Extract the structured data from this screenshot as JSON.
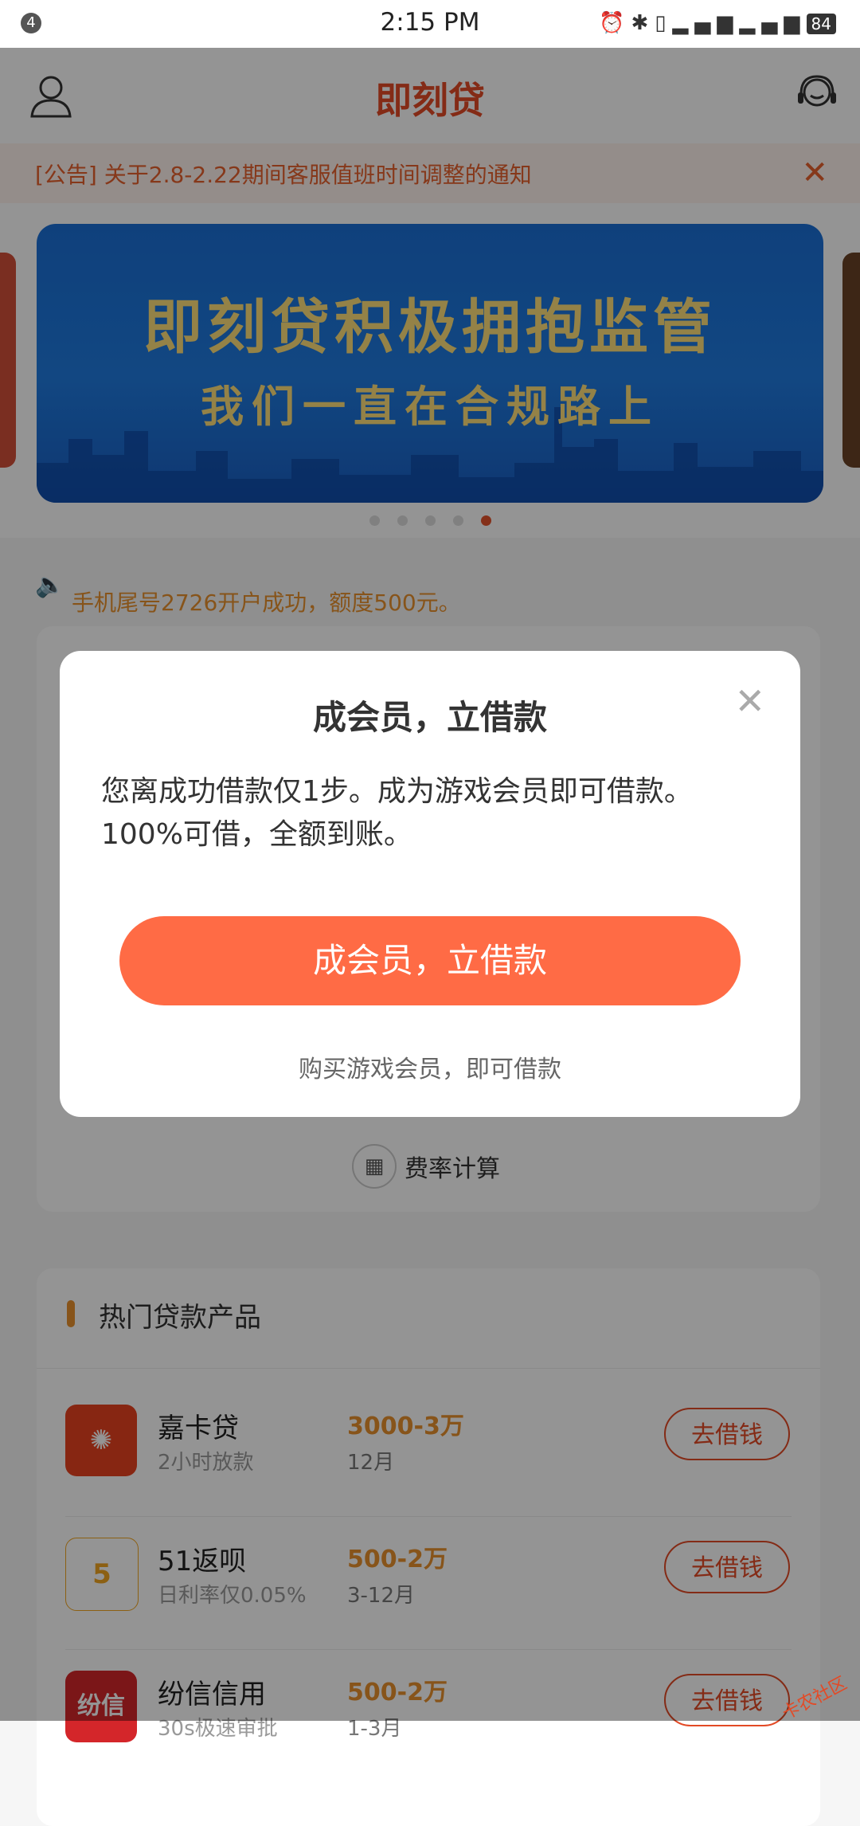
{
  "status_bar": {
    "notification_count": "4",
    "time": "2:15 PM",
    "battery": "84",
    "icons": [
      "alarm-icon",
      "bluetooth-icon",
      "vibrate-icon",
      "signal-icon",
      "4g-signal-icon",
      "battery-icon"
    ]
  },
  "header": {
    "title": "即刻贷",
    "left_icon": "user-icon",
    "right_icon": "customer-service-icon"
  },
  "notice": {
    "text": "[公告] 关于2.8-2.22期间客服值班时间调整的通知"
  },
  "banner": {
    "headline": "即刻贷积极拥抱监管",
    "subline": "我们一直在合规路上",
    "slide_count": 5,
    "active_slide": 5
  },
  "ticker": {
    "text": "手机尾号2726开户成功，额度500元。"
  },
  "loan_card": {
    "calc_label": "费率计算"
  },
  "hot_products": {
    "title": "热门贷款产品",
    "items": [
      {
        "name": "嘉卡贷",
        "sub": "2小时放款",
        "amount": "3000-3万",
        "term": "12月",
        "button": "去借钱",
        "logo_color": "#e8431f"
      },
      {
        "name": "51返呗",
        "sub": "日利率仅0.05%",
        "amount": "500-2万",
        "term": "3-12月",
        "button": "去借钱",
        "logo_color": "#f1a521"
      },
      {
        "name": "纷信信用",
        "sub": "30s极速审批",
        "amount": "500-2万",
        "term": "1-3月",
        "button": "去借钱",
        "logo_color": "#d4262a"
      }
    ]
  },
  "modal": {
    "title": "成会员，立借款",
    "body": "您离成功借款仅1步。成为游戏会员即可借款。100%可借，全额到账。",
    "button": "成会员，立借款",
    "hint": "购买游戏会员，即可借款"
  },
  "watermark": "卡农社区"
}
